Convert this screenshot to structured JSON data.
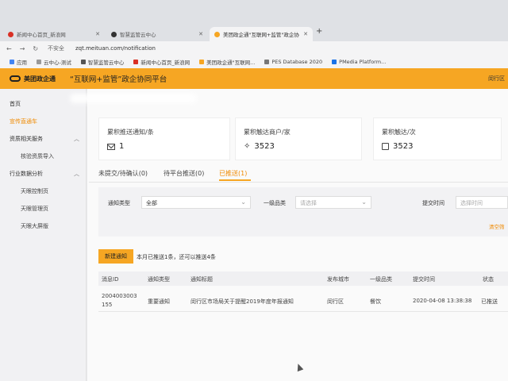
{
  "browser": {
    "tabs": [
      {
        "label": "新闻中心首页_新浪网",
        "favicon_color": "#d93025"
      },
      {
        "label": "智慧监管云中心",
        "favicon_color": "#333333"
      },
      {
        "label": "美团政企通\"互联网+监管\"政企协",
        "favicon_color": "#f6a623"
      }
    ],
    "address": {
      "insecure_label": "不安全",
      "url": "zqt.meituan.com/notification"
    },
    "bookmarks": [
      {
        "label": "应用",
        "color": "#4285f4"
      },
      {
        "label": "云中心-测试",
        "color": "#999999"
      },
      {
        "label": "智慧监管云中心",
        "color": "#555555"
      },
      {
        "label": "新闻中心首页_新浪网",
        "color": "#d93025"
      },
      {
        "label": "美团政企通\"互联网...",
        "color": "#f6a623"
      },
      {
        "label": "PES Database 2020",
        "color": "#777777"
      },
      {
        "label": "PMedia Platform...",
        "color": "#1a73e8"
      }
    ]
  },
  "app": {
    "logo_text": "美团政企通",
    "platform_title": "“互联网+监管”政企协同平台",
    "user": "闵行区"
  },
  "sidebar": {
    "items": [
      {
        "label": "首页"
      },
      {
        "label": "宣传直通车"
      },
      {
        "label": "资质相关服务"
      },
      {
        "label": "核验资质导入"
      },
      {
        "label": "行业数据分析"
      },
      {
        "label": "天眼控制页"
      },
      {
        "label": "天眼管理页"
      },
      {
        "label": "天眼大屏版"
      }
    ]
  },
  "stats": [
    {
      "label": "累积推送通知/条",
      "value": "1",
      "icon": "envelope-icon"
    },
    {
      "label": "累积触达商户/家",
      "value": "3523",
      "icon": "navigation-icon"
    },
    {
      "label": "累积触达/次",
      "value": "3523",
      "icon": "display-icon"
    }
  ],
  "tabs": [
    {
      "label": "未提交/待确认(0)"
    },
    {
      "label": "待平台推送(0)"
    },
    {
      "label": "已推送(1)"
    }
  ],
  "filters": {
    "type_label": "通知类型",
    "type_value": "全部",
    "category_label": "一级品类",
    "category_placeholder": "请选择",
    "time_label": "提交时间",
    "time_placeholder": "选择时间",
    "clear_label": "清空筛"
  },
  "actions": {
    "new_label": "新建通知",
    "quota_text": "本月已推送1条，还可以推送4条"
  },
  "table": {
    "headers": [
      "消息ID",
      "通知类型",
      "通知标题",
      "发布城市",
      "一级品类",
      "提交时间",
      "状态"
    ],
    "rows": [
      {
        "id_line1": "2004003003",
        "id_line2": "155",
        "type": "重要通知",
        "title": "闵行区市场局关于提醒2019年度年报通知",
        "city": "闵行区",
        "category": "餐饮",
        "time": "2020-04-08 13:38:38",
        "status": "已推送"
      }
    ]
  },
  "colors": {
    "accent": "#f6a623",
    "accent_text": "#f08a00"
  }
}
